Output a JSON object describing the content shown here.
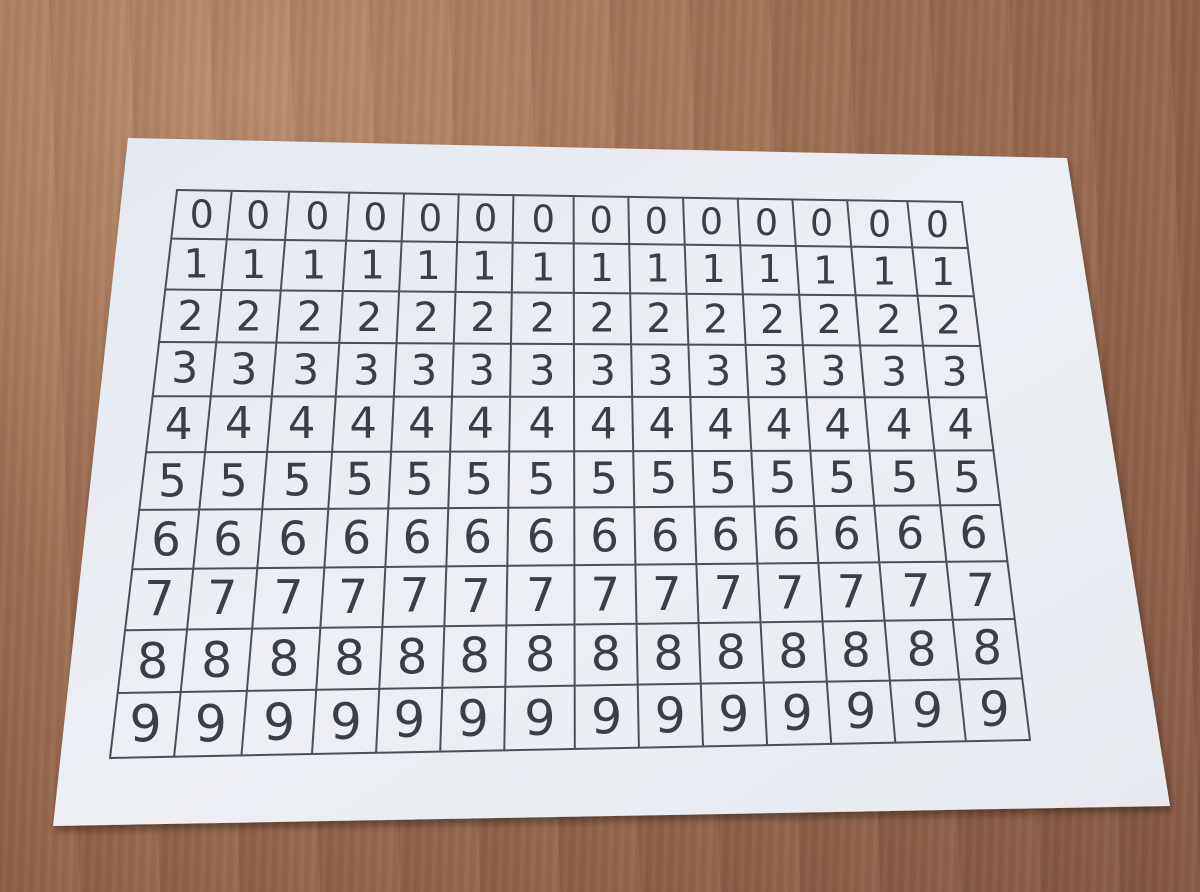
{
  "grid": {
    "rows": [
      {
        "digit": "0",
        "cells": [
          "0",
          "0",
          "0",
          "0",
          "0",
          "0",
          "0",
          "0",
          "0",
          "0",
          "0",
          "0",
          "0",
          "0"
        ]
      },
      {
        "digit": "1",
        "cells": [
          "1",
          "1",
          "1",
          "1",
          "1",
          "1",
          "1",
          "1",
          "1",
          "1",
          "1",
          "1",
          "1",
          "1"
        ]
      },
      {
        "digit": "2",
        "cells": [
          "2",
          "2",
          "2",
          "2",
          "2",
          "2",
          "2",
          "2",
          "2",
          "2",
          "2",
          "2",
          "2",
          "2"
        ]
      },
      {
        "digit": "3",
        "cells": [
          "3",
          "3",
          "3",
          "3",
          "3",
          "3",
          "3",
          "3",
          "3",
          "3",
          "3",
          "3",
          "3",
          "3"
        ]
      },
      {
        "digit": "4",
        "cells": [
          "4",
          "4",
          "4",
          "4",
          "4",
          "4",
          "4",
          "4",
          "4",
          "4",
          "4",
          "4",
          "4",
          "4"
        ]
      },
      {
        "digit": "5",
        "cells": [
          "5",
          "5",
          "5",
          "5",
          "5",
          "5",
          "5",
          "5",
          "5",
          "5",
          "5",
          "5",
          "5",
          "5"
        ]
      },
      {
        "digit": "6",
        "cells": [
          "6",
          "6",
          "6",
          "6",
          "6",
          "6",
          "6",
          "6",
          "6",
          "6",
          "6",
          "6",
          "6",
          "6"
        ]
      },
      {
        "digit": "7",
        "cells": [
          "7",
          "7",
          "7",
          "7",
          "7",
          "7",
          "7",
          "7",
          "7",
          "7",
          "7",
          "7",
          "7",
          "7"
        ]
      },
      {
        "digit": "8",
        "cells": [
          "8",
          "8",
          "8",
          "8",
          "8",
          "8",
          "8",
          "8",
          "8",
          "8",
          "8",
          "8",
          "8",
          "8"
        ]
      },
      {
        "digit": "9",
        "cells": [
          "9",
          "9",
          "9",
          "9",
          "9",
          "9",
          "9",
          "9",
          "9",
          "9",
          "9",
          "9",
          "9",
          "9"
        ]
      }
    ]
  },
  "colors": {
    "table": "#93654a",
    "paper": "#e9edf2",
    "grid_lines": "#4a4e58",
    "digits": "#3a3e48"
  }
}
